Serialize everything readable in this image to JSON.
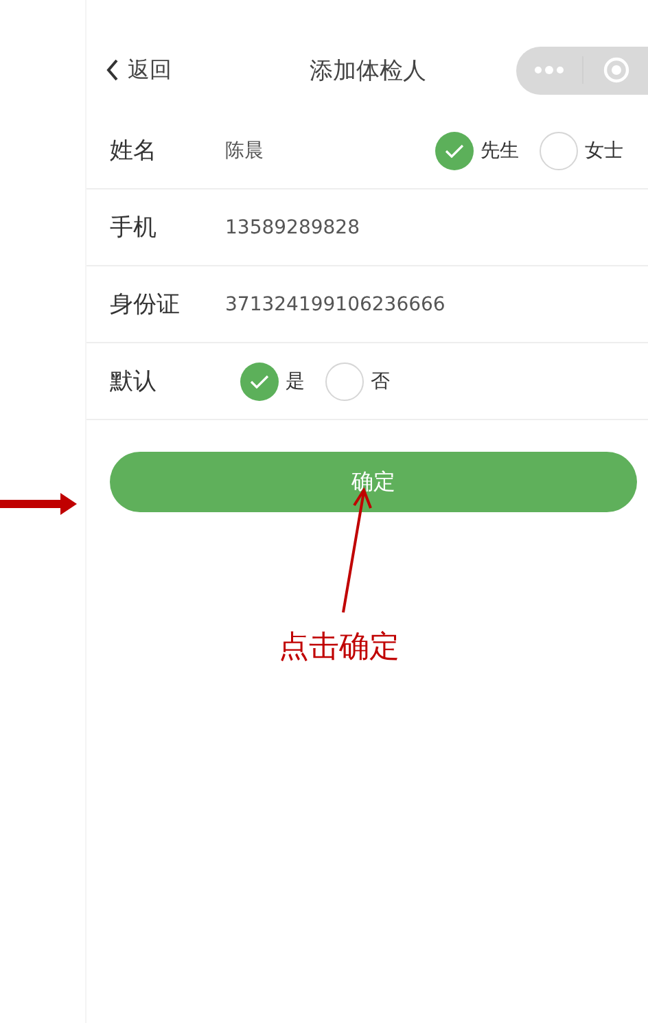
{
  "header": {
    "back": "返回",
    "title": "添加体检人"
  },
  "fields": [
    {
      "kind": "text",
      "label": "姓名",
      "value": "陈晨",
      "options": [
        {
          "label": "先生",
          "selected": true
        },
        {
          "label": "女士",
          "selected": false
        }
      ]
    },
    {
      "kind": "text",
      "label": "手机",
      "value": "13589289828"
    },
    {
      "kind": "text",
      "label": "身份证",
      "value": "371324199106236666"
    },
    {
      "kind": "choice",
      "label": "默认",
      "options": [
        {
          "label": "是",
          "selected": true
        },
        {
          "label": "否",
          "selected": false
        }
      ]
    }
  ],
  "confirm_button": "确定",
  "annotation": {
    "callout": "点击确定"
  }
}
